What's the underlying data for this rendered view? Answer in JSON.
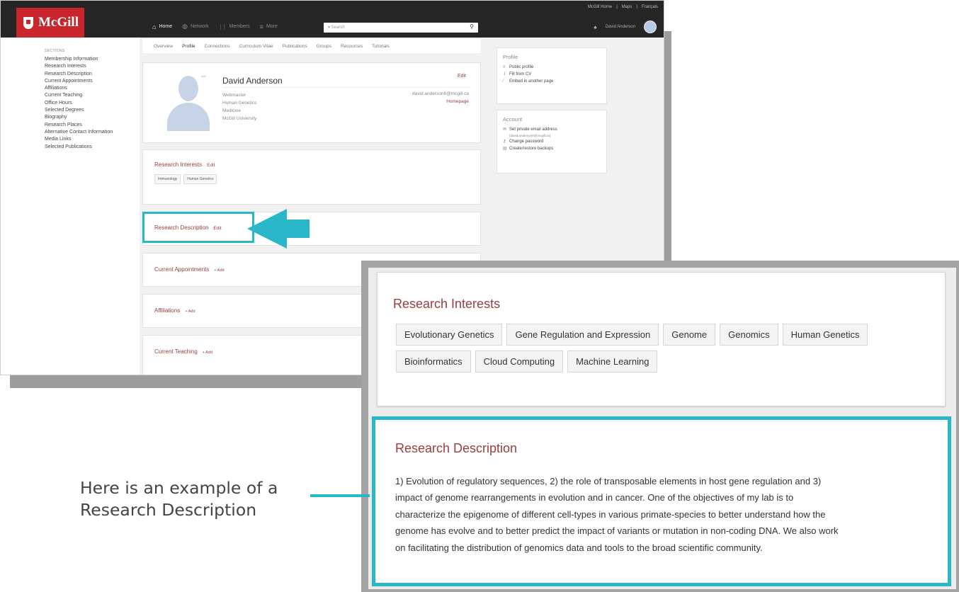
{
  "screenshot": {
    "logo": "McGill",
    "top_links": [
      "McGill Home",
      "|",
      "Maps",
      "|",
      "Français"
    ],
    "nav": [
      {
        "icon": "house-icon",
        "glyph": "⌂",
        "label": "Home"
      },
      {
        "icon": "globe-icon",
        "glyph": "◍",
        "label": "Network"
      },
      {
        "icon": "people-icon",
        "glyph": "ᛁᛁ",
        "label": "Members"
      },
      {
        "icon": "menu-icon",
        "glyph": "≡",
        "label": "More"
      }
    ],
    "search_placeholder": "▾ Search",
    "search_icon": "⚲",
    "bell_icon": "bell-icon",
    "user_name": "David Anderson",
    "sidebar_heading": "SECTIONS",
    "sidebar_items": [
      "Membership Information",
      "Research Interests",
      "Research Description",
      "Current Appointments",
      "Affiliations",
      "Current Teaching",
      "Office Hours",
      "Selected Degrees",
      "Biography",
      "Research Places",
      "Alternative Contact Information",
      "Media Links",
      "Selected Publications"
    ],
    "tabs": [
      "Overview",
      "Profile",
      "Connections",
      "Curriculum Vitae",
      "Publications",
      "Groups",
      "Resources",
      "Tutorials"
    ],
    "active_tab": "Profile",
    "profile": {
      "photo_edit": "edit",
      "name": "David Anderson",
      "edit": "Edit",
      "lines": [
        "Webmaster",
        "Human Genetics",
        "Medicine",
        "McGill University"
      ],
      "email": "david.anderson6@mcgill.ca",
      "homepage": "Homepage"
    },
    "research_interests": {
      "title": "Research Interests",
      "edit": "Edit",
      "tags": [
        "Immunology",
        "Human Genetics"
      ]
    },
    "research_description": {
      "title": "Research Description",
      "edit": "Edit"
    },
    "current_appointments": {
      "title": "Current Appointments",
      "add": "+ Add"
    },
    "affiliations": {
      "title": "Affiliations",
      "add": "+ Add"
    },
    "current_teaching": {
      "title": "Current Teaching",
      "add": "+ Add"
    },
    "side_profile": {
      "title": "Profile",
      "items": [
        {
          "glyph": "≡",
          "label": "Public profile"
        },
        {
          "glyph": "⇃",
          "label": "Fill from CV"
        },
        {
          "glyph": "⁄",
          "label": "Embed in another page"
        }
      ]
    },
    "side_account": {
      "title": "Account",
      "items": [
        {
          "glyph": "✉",
          "label": "Set private email address"
        },
        {
          "glyph": "",
          "label": "(david.anderson6@mcgill.ca)",
          "sub": true
        },
        {
          "glyph": "⚷",
          "label": "Change password"
        },
        {
          "glyph": "▤",
          "label": "Create/restore backups"
        }
      ]
    }
  },
  "zoom": {
    "research_interests_title": "Research Interests",
    "tags": [
      "Evolutionary Genetics",
      "Gene Regulation and Expression",
      "Genome",
      "Genomics",
      "Human Genetics",
      "Bioinformatics",
      "Cloud Computing",
      "Machine Learning"
    ],
    "research_description_title": "Research Description",
    "research_description_lines": [
      "1) Evolution of regulatory sequences, 2) the role of transposable elements in host gene regulation and 3)",
      "impact of genome rearrangements in evolution and in cancer. One of the objectives of my lab is to",
      "characterize the epigenome of different cell-types in various primate-species to better understand how the",
      "genome has evolve and to better predict the impact of variants or mutation in non-coding DNA. We also work",
      "on facilitating the distribution of genomics data and tools to the broad scientific community."
    ]
  },
  "callout": {
    "line1": "Here is an example of a",
    "line2": "Research Description"
  },
  "colors": {
    "accent": "#2ab7c9",
    "brand": "#c9252c",
    "link": "#9a3d3d"
  }
}
